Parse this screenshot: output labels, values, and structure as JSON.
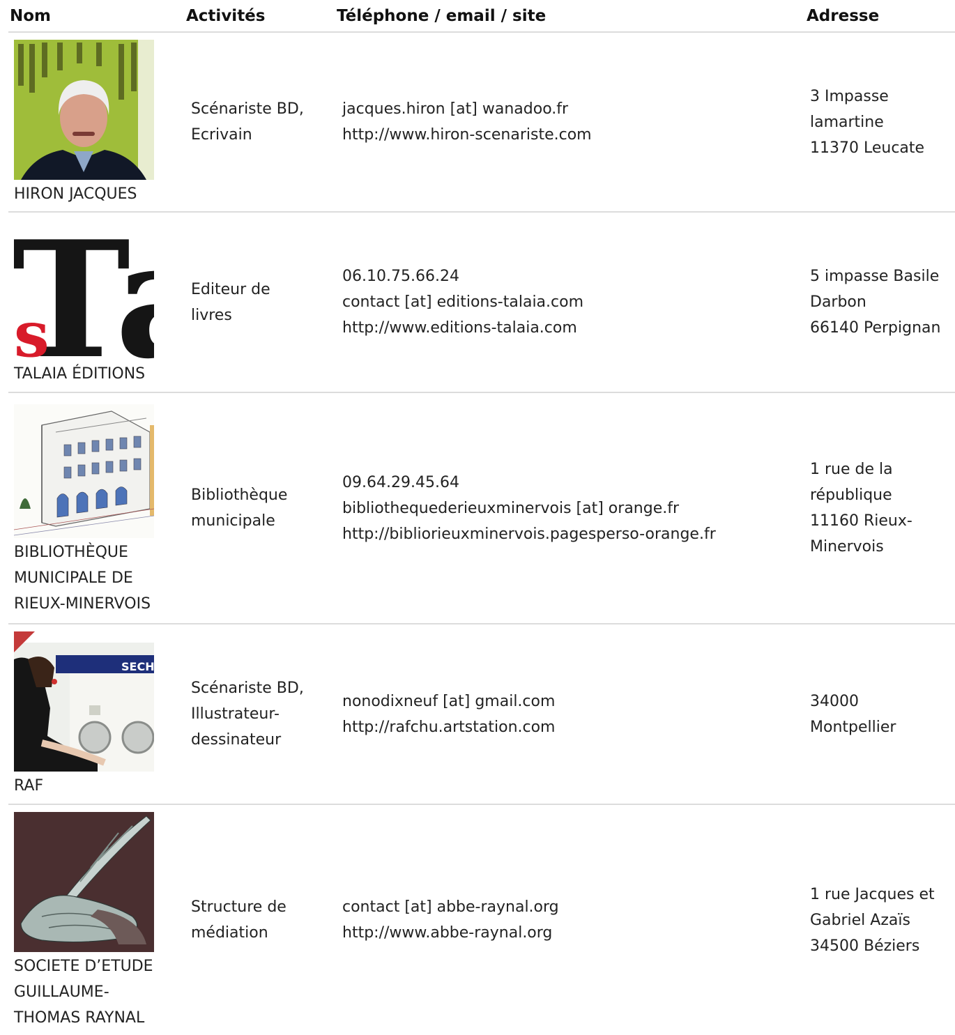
{
  "headers": {
    "name": "Nom",
    "activities": "Activités",
    "contact": "Téléphone / email / site",
    "address": "Adresse"
  },
  "rows": [
    {
      "name": "HIRON JACQUES",
      "photo": "portrait-photo",
      "activities": [
        "Scénariste BD,",
        "Ecrivain"
      ],
      "contact": [
        "jacques.hiron [at] wanadoo.fr",
        "http://www.hiron-scenariste.com"
      ],
      "address": [
        "3 Impasse",
        "lamartine",
        "11370 Leucate"
      ]
    },
    {
      "name": "TALAIA ÉDITIONS",
      "photo": "publisher-logo",
      "activities": [
        "Editeur de",
        "livres"
      ],
      "contact": [
        "06.10.75.66.24",
        "contact [at] editions-talaia.com",
        "http://www.editions-talaia.com"
      ],
      "address": [
        "5 impasse Basile",
        "Darbon",
        "66140 Perpignan"
      ]
    },
    {
      "name": "BIBLIOTHÈQUE MUNICIPALE DE RIEUX-MINERVOIS",
      "name_lines": [
        "BIBLIOTHÈQUE",
        "MUNICIPALE DE",
        "RIEUX-MINERVOIS"
      ],
      "photo": "building-sketch",
      "activities": [
        "Bibliothèque",
        "municipale"
      ],
      "contact": [
        "09.64.29.45.64",
        "bibliothequederieuxminervois [at] orange.fr",
        "http://bibliorieuxminervois.pagesperso-orange.fr"
      ],
      "address": [
        "1 rue de la",
        "république",
        "11160 Rieux-",
        "Minervois"
      ]
    },
    {
      "name": "RAF",
      "photo": "laundromat-photo",
      "activities": [
        "Scénariste BD,",
        "Illustrateur-",
        "dessinateur"
      ],
      "contact": [
        "nonodixneuf [at] gmail.com",
        "http://rafchu.artstation.com"
      ],
      "address": [
        "34000",
        "Montpellier"
      ]
    },
    {
      "name": "SOCIETE D’ETUDE GUILLAUME-THOMAS RAYNAL",
      "name_lines": [
        "SOCIETE D’ETUDE",
        "GUILLAUME-",
        "THOMAS RAYNAL"
      ],
      "photo": "quill-engraving",
      "activities": [
        "Structure de",
        "médiation"
      ],
      "contact": [
        "contact [at] abbe-raynal.org",
        "http://www.abbe-raynal.org"
      ],
      "address": [
        "1 rue Jacques et",
        "Gabriel Azaïs",
        "34500 Béziers"
      ]
    }
  ],
  "images": {
    "talaia_logo_text": "Ta",
    "talaia_logo_s": "s",
    "laundromat_sign": "SECH"
  }
}
